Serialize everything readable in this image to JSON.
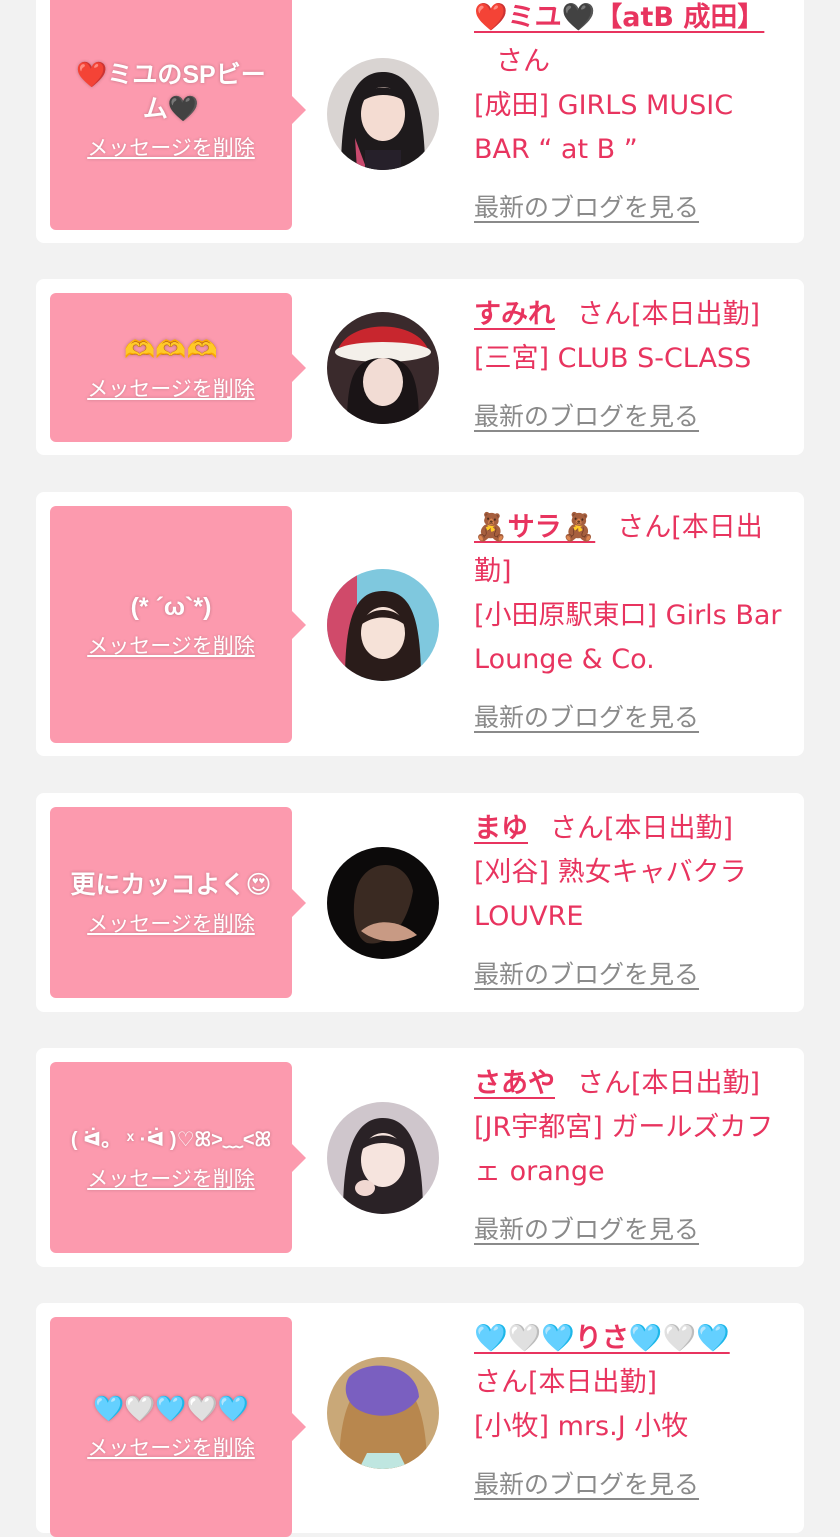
{
  "common": {
    "delete_label": "メッセージを削除",
    "san_label": "さん",
    "blog_label": "最新のブログを見る"
  },
  "colors": {
    "page_bg": "#f2f2f2",
    "card_bg": "#ffffff",
    "bubble_bg": "#fc9aae",
    "accent": "#e8345f",
    "link_gray": "#8a8a8a"
  },
  "cards": [
    {
      "message": "❤️ミユのSPビーム🖤",
      "name": "❤️ミユ🖤【atB 成田】",
      "status": "",
      "shop": "[成田] GIRLS MUSIC BAR “ at B ”",
      "avatar_icon": "girl-avatar-icon"
    },
    {
      "message": "🫶🫶🫶",
      "name": "すみれ",
      "status": "[本日出勤]",
      "shop": "[三宮] CLUB S-CLASS",
      "avatar_icon": "girl-avatar-icon"
    },
    {
      "message": "(* ´ω`*)",
      "name": "🧸サラ🧸",
      "status": "[本日出勤]",
      "shop": "[小田原駅東口] Girls Bar Lounge & Co.",
      "avatar_icon": "girl-avatar-icon"
    },
    {
      "message": "更にカッコよく😍",
      "name": "まゆ",
      "status": "[本日出勤]",
      "shop": "[刈谷] 熟女キャバクラ LOUVRE",
      "avatar_icon": "girl-avatar-icon"
    },
    {
      "message": "( ᐛ。 ˣ ·ᐛ )♡ꕤ>﹏<ꕤ",
      "name": "さあや",
      "status": "[本日出勤]",
      "shop": "[JR宇都宮] ガールズカフェ orange",
      "avatar_icon": "girl-avatar-icon"
    },
    {
      "message": "🩵🤍🩵🤍🩵",
      "name": "🩵🤍🩵りさ🩵🤍🩵",
      "status": "[本日出勤]",
      "shop": "[小牧] mrs.J 小牧",
      "avatar_icon": "girl-avatar-icon"
    }
  ]
}
